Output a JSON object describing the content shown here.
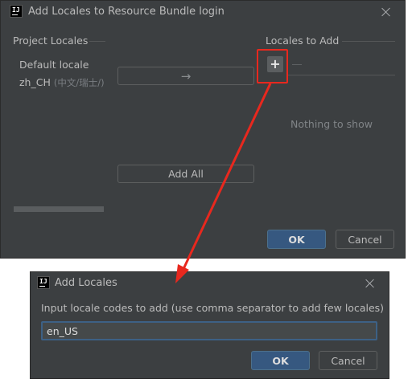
{
  "main_dialog": {
    "title": "Add Locales to Resource Bundle login",
    "project_locales": {
      "heading": "Project Locales",
      "items": [
        {
          "label": "Default locale",
          "detail": ""
        },
        {
          "label": "zh_CH",
          "detail": "(中文/瑞士/)"
        }
      ]
    },
    "move_button": {
      "icon": "arrow-right-icon",
      "glyph": "→"
    },
    "add_all_label": "Add All",
    "locales_to_add": {
      "heading": "Locales to Add",
      "plus_glyph": "+",
      "empty_text": "Nothing to show"
    },
    "ok_label": "OK",
    "cancel_label": "Cancel"
  },
  "add_locales_dialog": {
    "title": "Add Locales",
    "prompt": "Input locale codes to add (use comma separator to add few locales)",
    "input_value": "en_US",
    "ok_label": "OK",
    "cancel_label": "Cancel"
  },
  "colors": {
    "dialog_bg": "#3c3f41",
    "primary_button": "#365880",
    "annotation_red": "#e8281e"
  },
  "app_icon_text": "IJ"
}
